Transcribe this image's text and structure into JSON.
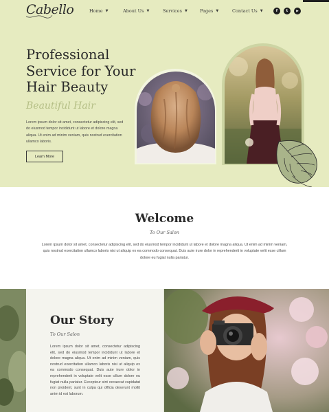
{
  "brand": {
    "logo_text": "Cabello"
  },
  "nav": {
    "items": [
      {
        "label": "Home",
        "has_dropdown": true
      },
      {
        "label": "About Us",
        "has_dropdown": true
      },
      {
        "label": "Services",
        "has_dropdown": true
      },
      {
        "label": "Pages",
        "has_dropdown": true
      },
      {
        "label": "Contact Us",
        "has_dropdown": true
      }
    ]
  },
  "social": [
    {
      "icon": "facebook-icon",
      "glyph": "f"
    },
    {
      "icon": "twitter-icon",
      "glyph": "t"
    },
    {
      "icon": "youtube-icon",
      "glyph": "▶"
    }
  ],
  "hero": {
    "title": "Professional Service for Your Hair Beauty",
    "script": "Beautiful Hair",
    "text": "Lorem ipsum dolor sit amet, consectetur adipiscing elit, sed do eiusmod tempor incididunt ut labore et dolore magna aliqua. Ut enim ad minim veniam, quis nostrud exercitation ullamco laboris.",
    "button_label": "Learn More"
  },
  "welcome": {
    "title": "Welcome",
    "subtitle": "To Our Salon",
    "text": "Lorem ipsum dolor sit amet, consectetur adipiscing elit, sed do eiusmod tempor incididunt ut labore et dolore magna aliqua. Ut enim ad minim veniam, quis nostrud exercitation ullamco laboris nisi ut aliquip ex ea commodo consequat. Duis aute irure dolor in reprehenderit in voluptate velit esse cillum dolore eu fugiat nulla pariatur."
  },
  "story": {
    "title": "Our Story",
    "subtitle": "To Our Salon",
    "text": "Lorem ipsum dolor sit amet, consectetur adipiscing elit, sed do eiusmod tempor incididunt ut labore et dolore magna aliqua. Ut enim ad minim veniam, quis nostrud exercitation ullamco laboris nisi ut aliquip ex ea commodo consequat. Duis aute irure dolor in reprehenderit in voluptate velit esse cillum dolore eu fugiat nulla pariatur. Excepteur sint occaecat cupidatat non proident, sunt in culpa qui officia deserunt mollit anim id est laborum."
  },
  "colors": {
    "hero_bg": "#e6ebc0",
    "accent_script": "#b5bf86",
    "text_dark": "#2a2a2a",
    "story_card": "#f4f4ee"
  }
}
